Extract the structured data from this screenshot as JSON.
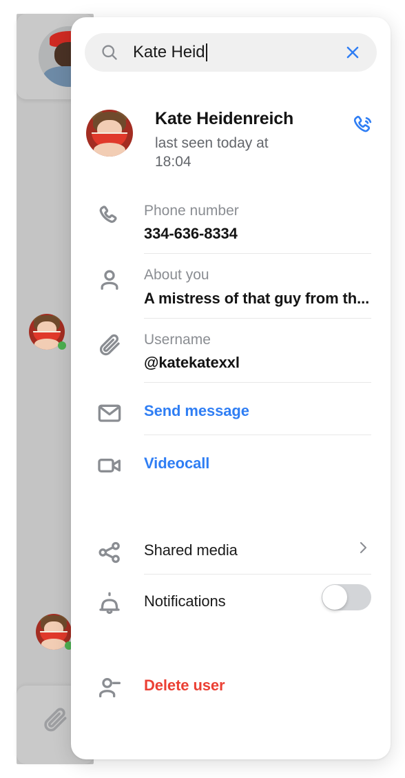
{
  "search": {
    "value": "Kate Heid",
    "placeholder": "Search",
    "icon": "search-icon",
    "clear_icon": "close-icon"
  },
  "contact": {
    "name": "Kate Heidenreich",
    "status": "last seen today at 18:04",
    "avatar_icon": "avatar-kate-watermelon",
    "call_icon": "phone-call-icon",
    "accent_color": "#2f7ef4"
  },
  "fields": [
    {
      "icon": "phone-icon",
      "label": "Phone number",
      "value": "334-636-8334"
    },
    {
      "icon": "person-icon",
      "label": "About you",
      "value": "A mistress of that guy from th..."
    },
    {
      "icon": "paperclip-icon",
      "label": "Username",
      "value": "@katekatexxl"
    }
  ],
  "actions": [
    {
      "icon": "envelope-icon",
      "label": "Send message",
      "color": "#2f7ef4"
    },
    {
      "icon": "video-camera-icon",
      "label": "Videocall",
      "color": "#2f7ef4"
    }
  ],
  "nav": {
    "icon": "share-icon",
    "label": "Shared media",
    "chevron_icon": "chevron-right-icon"
  },
  "notifications": {
    "icon": "bell-icon",
    "label": "Notifications",
    "enabled": false
  },
  "delete": {
    "icon": "person-minus-icon",
    "label": "Delete user",
    "color": "#eb4034"
  },
  "background": {
    "avatars": [
      "avatar-man-red-cap",
      "avatar-kate-watermelon",
      "avatar-kate-watermelon"
    ],
    "attachment_icon": "paperclip-icon"
  }
}
